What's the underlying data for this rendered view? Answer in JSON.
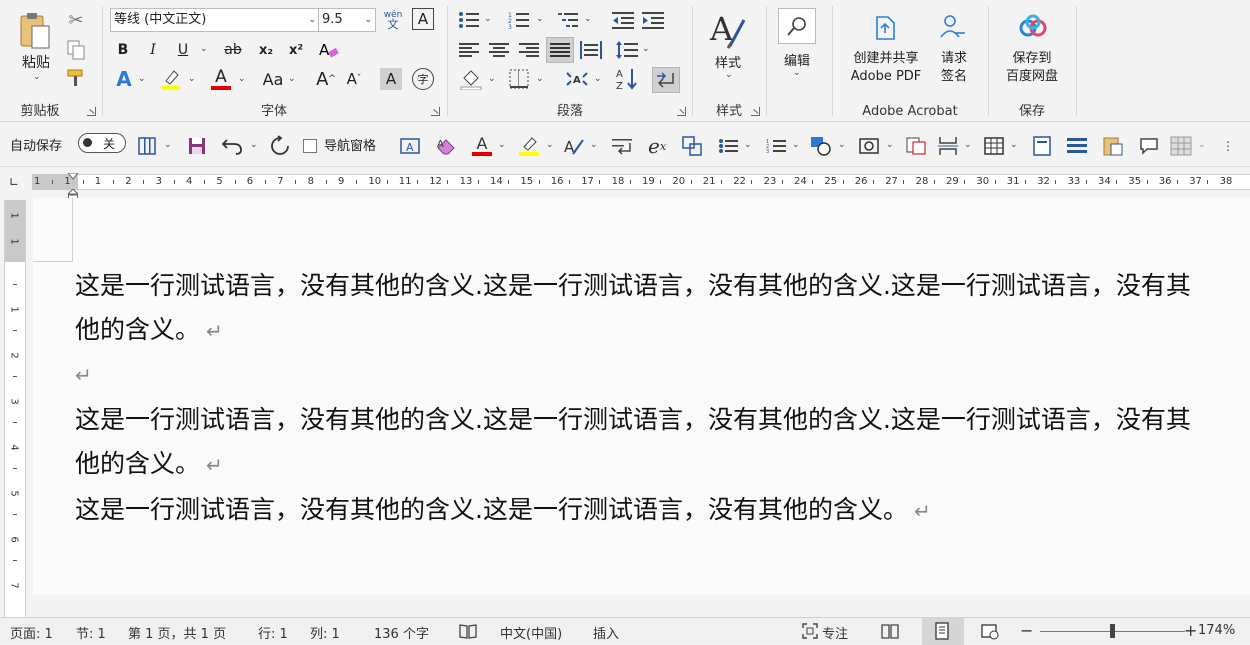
{
  "ribbon": {
    "clipboard": {
      "label": "剪贴板",
      "paste": "粘贴"
    },
    "font": {
      "label": "字体",
      "font_name": "等线 (中文正文)",
      "font_size": "9.5",
      "phonetic_top": "wén",
      "phonetic_bottom": "文",
      "bold": "B",
      "italic": "I",
      "underline": "U",
      "strike": "ab",
      "subscript": "x₂",
      "superscript": "x²",
      "change_case": "Aa",
      "grow": "A",
      "shrink": "A",
      "enclose": "字"
    },
    "paragraph": {
      "label": "段落"
    },
    "styles": {
      "label": "样式",
      "button": "样式"
    },
    "editing": {
      "button": "编辑"
    },
    "acrobat": {
      "label": "Adobe Acrobat",
      "create_pdf_line1": "创建并共享",
      "create_pdf_line2": "Adobe PDF",
      "request_line1": "请求",
      "request_line2": "签名"
    },
    "save": {
      "label": "保存",
      "line1": "保存到",
      "line2": "百度网盘"
    }
  },
  "qat": {
    "autosave_label": "自动保存",
    "autosave_state": "关",
    "nav_pane_label": "导航窗格"
  },
  "ruler": {
    "h_numbers": [
      "1",
      "1",
      "1",
      "2",
      "3",
      "4",
      "5",
      "6",
      "7",
      "8",
      "9",
      "10",
      "11",
      "12",
      "13",
      "14",
      "15",
      "16",
      "17",
      "18",
      "19",
      "20",
      "21",
      "22",
      "23",
      "24",
      "25",
      "26",
      "27",
      "28",
      "29",
      "30",
      "31",
      "32",
      "33",
      "34",
      "35",
      "36",
      "37",
      "38"
    ],
    "v_numbers": [
      "1",
      "1",
      "1",
      "2",
      "3",
      "4",
      "5",
      "6",
      "7"
    ]
  },
  "document": {
    "paragraphs": [
      "这是一行测试语言，没有其他的含义.这是一行测试语言，没有其他的含义.这是一行测试语言，没有其",
      "他的含义。",
      "",
      "这是一行测试语言，没有其他的含义.这是一行测试语言，没有其他的含义.这是一行测试语言，没有其",
      "他的含义。",
      "这是一行测试语言，没有其他的含义.这是一行测试语言，没有其他的含义。"
    ],
    "para_mark": "↵"
  },
  "status": {
    "page": "页面: 1",
    "section": "节: 1",
    "page_of": "第 1 页，共 1 页",
    "line": "行: 1",
    "column": "列: 1",
    "word_count": "136 个字",
    "language": "中文(中国)",
    "insert_mode": "插入",
    "focus": "专注",
    "zoom": "174%"
  },
  "colors": {
    "accent_blue": "#2b579a",
    "font_red": "#e00000",
    "highlight_yellow": "#ffff00",
    "save_purple": "#80397b"
  }
}
